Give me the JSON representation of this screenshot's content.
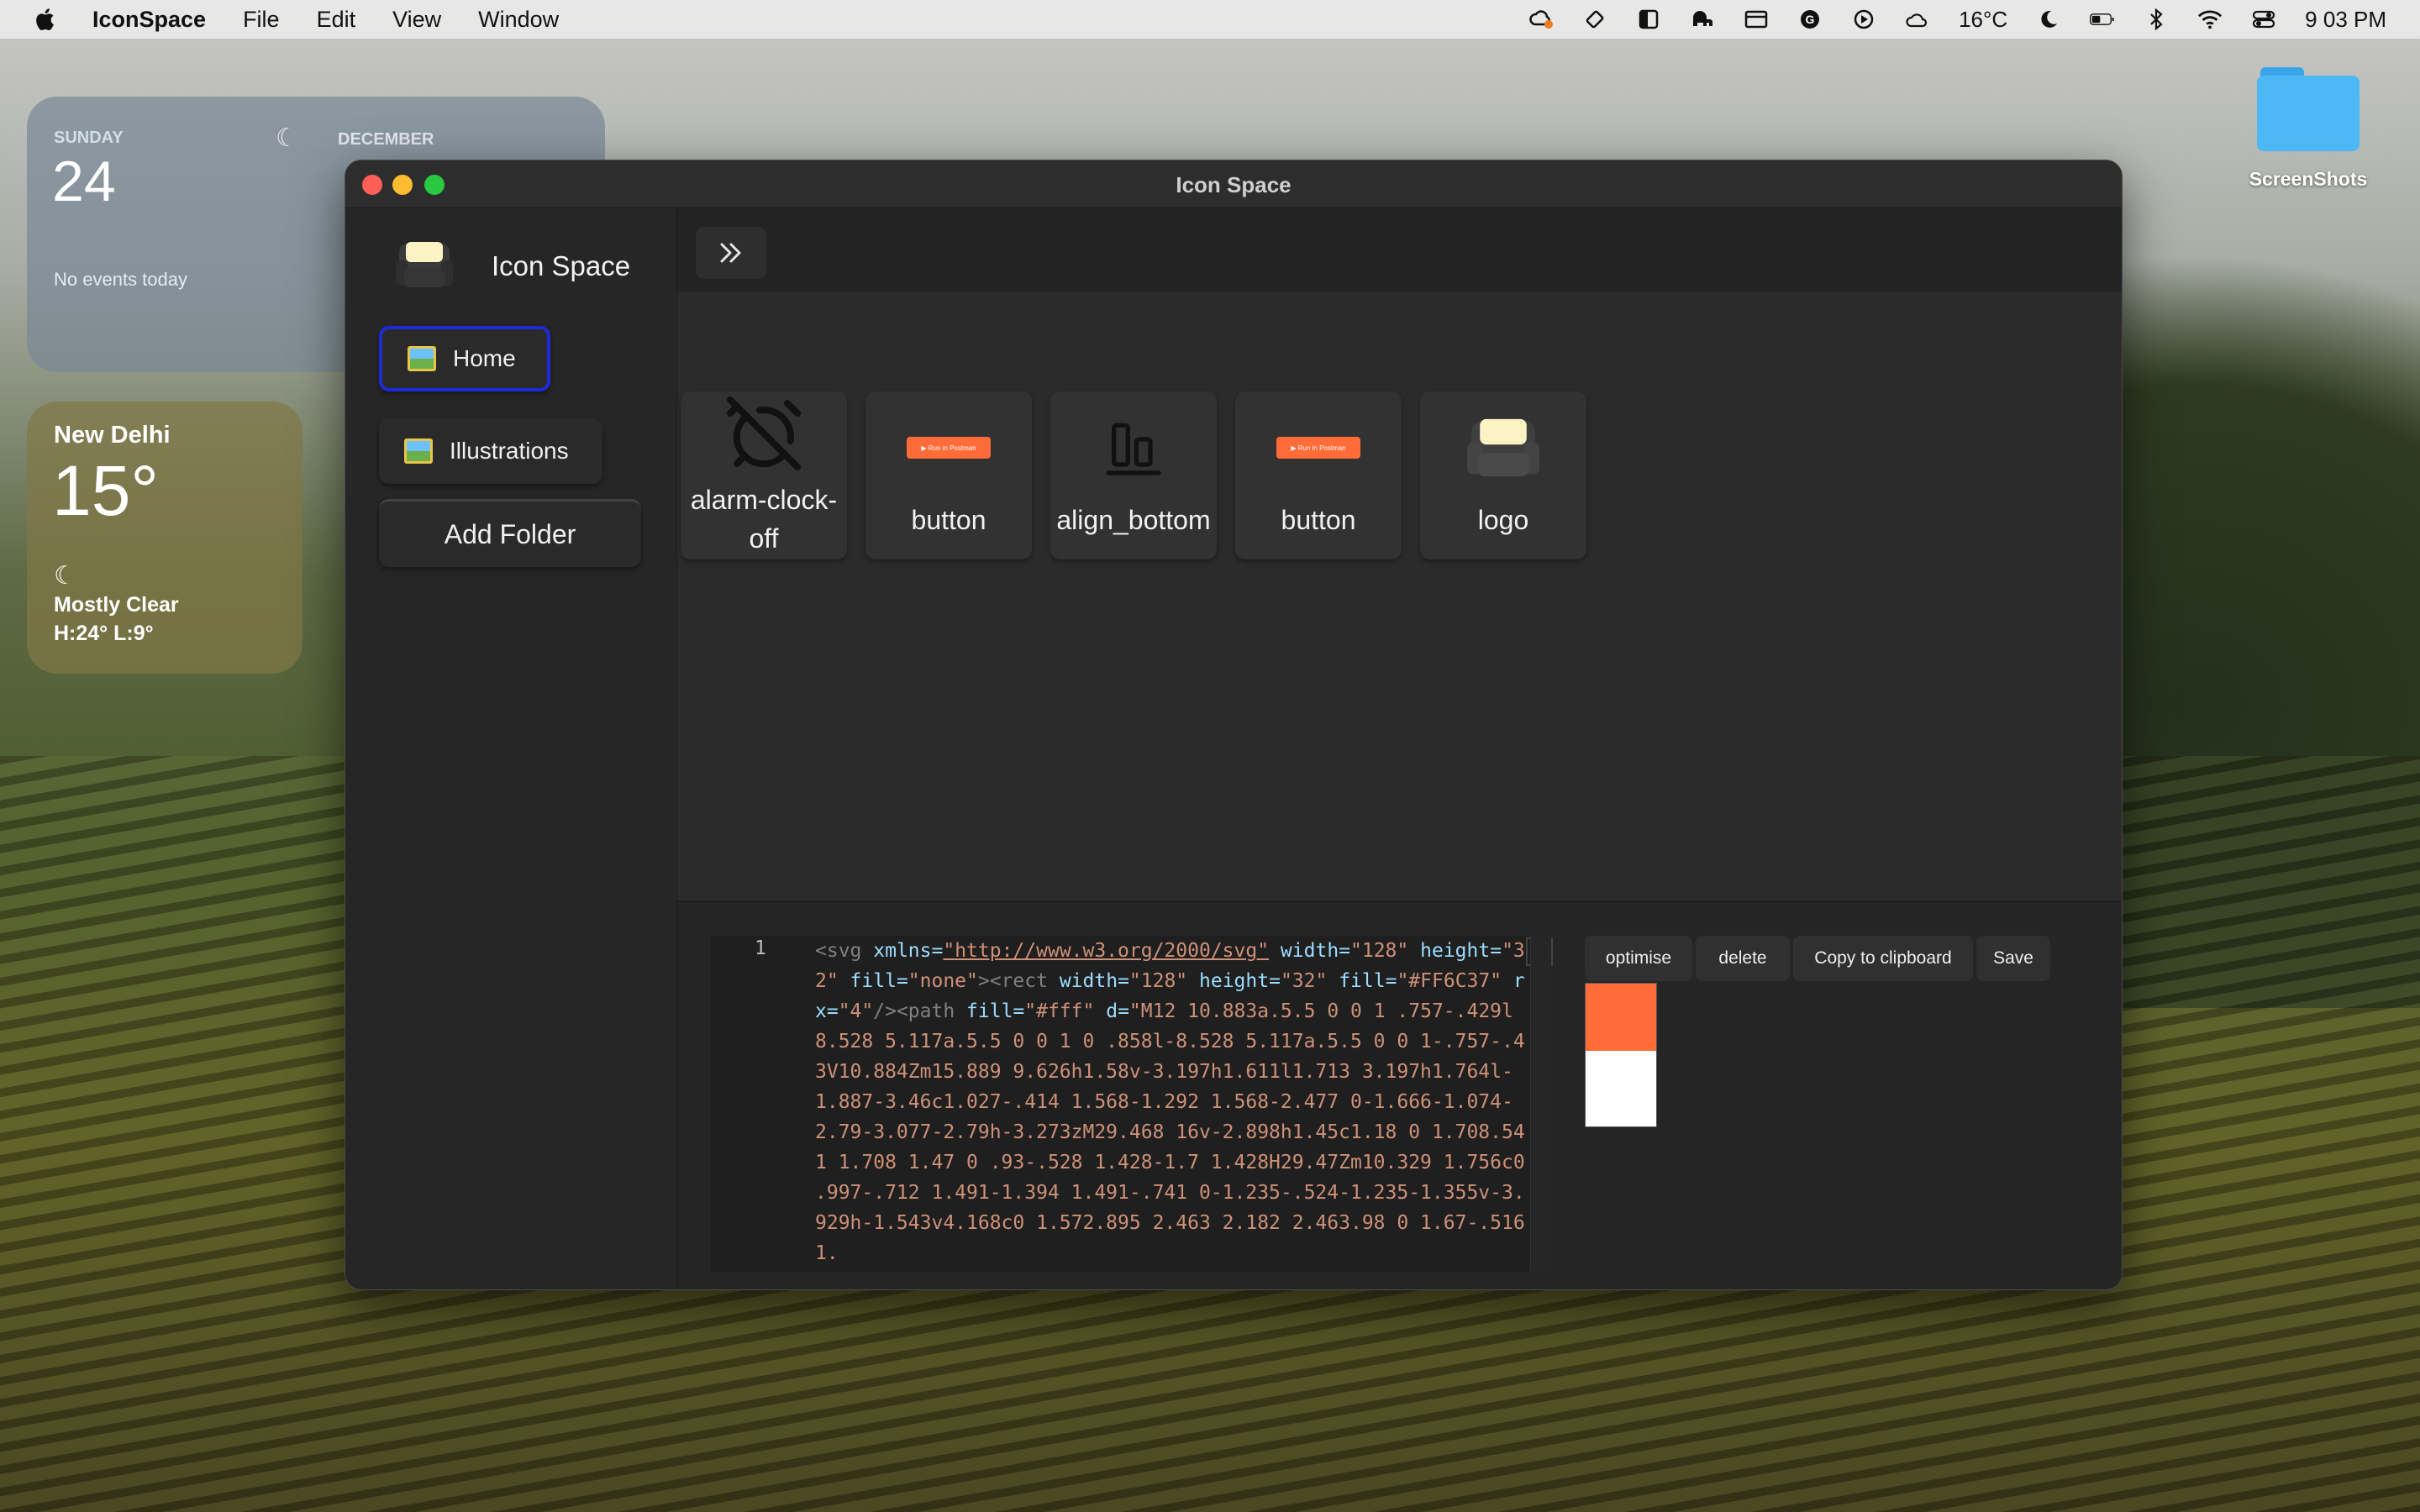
{
  "menubar": {
    "app_name": "IconSpace",
    "menus": [
      "File",
      "Edit",
      "View",
      "Window"
    ],
    "weather_temp": "16°C",
    "clock": "9 03 PM"
  },
  "calendar_widget": {
    "day_name": "SUNDAY",
    "date": "24",
    "month": "DECEMBER",
    "no_events": "No events today"
  },
  "weather_widget": {
    "city": "New Delhi",
    "temperature": "15°",
    "condition": "Mostly Clear",
    "high_low": "H:24° L:9°"
  },
  "desktop": {
    "folder_label": "ScreenShots"
  },
  "window": {
    "title": "Icon Space",
    "sidebar": {
      "brand": "Icon Space",
      "items": [
        {
          "label": "Home"
        },
        {
          "label": "Illustrations"
        }
      ],
      "add_folder": "Add Folder"
    },
    "icons": [
      {
        "line1": "alarm-clock-",
        "line2": "off"
      },
      {
        "label": "button",
        "art_text": "▶ Run in Postman"
      },
      {
        "label": "align_bottom"
      },
      {
        "label": "button",
        "art_text": "▶ Run in Postman"
      },
      {
        "label": "logo"
      }
    ],
    "editor": {
      "line_number": "1",
      "code": {
        "p1": "<svg ",
        "p2": "xmlns=",
        "p3": "\"http://www.w3.org/2000/svg\"",
        "p4": " width=",
        "p5": "\"128\"",
        "p6": "height=",
        "p7": "\"32\"",
        "p8": " fill=",
        "p9": "\"none\"",
        "p10": "><rect ",
        "p11": "width=",
        "p12": "\"128\"",
        "p13": " height=",
        "p14": "\"32\"",
        "p15": "fill=",
        "p16": "\"#FF6C37\"",
        "p17": " rx=",
        "p18": "\"4\"",
        "p19": "/><path ",
        "p20": "fill=",
        "p21": "\"#fff\"",
        "p22": " d=",
        "p23": "\"M12 10.883a.5.5 0 0 1 .757-.429l8.528 5.117a.5.5 0 0 1 0 .858l-8.528 5.117a.5.5 0 0 1-.757-.43V10.884Zm15.889 9.626h1.58v-3.197h1.611l1.713 3.197h1.764l-1.887-3.46c1.027-.414 1.568-1.292 1.568-2.477 0-1.666-1.074-2.79-3.077-2.79h-3.273zM29.468 16v-2.898h1.45c1.18 0 1.708.541 1.708 1.47 0 .93-.528 1.428-1.7 1.428H29.47Zm10.329 1.756c0 .997-.712 1.491-1.394 1.491-.741 0-1.235-.524-1.235-1.355v-3.929h-1.543v4.168c0 1.572.895 2.463 2.182 2.463.98 0 1.67-.516 1."
      }
    },
    "actions": {
      "optimise": "optimise",
      "delete": "delete",
      "copy": "Copy to clipboard",
      "save": "Save"
    },
    "swatches": [
      "#FF6C37",
      "#ffffff"
    ]
  }
}
